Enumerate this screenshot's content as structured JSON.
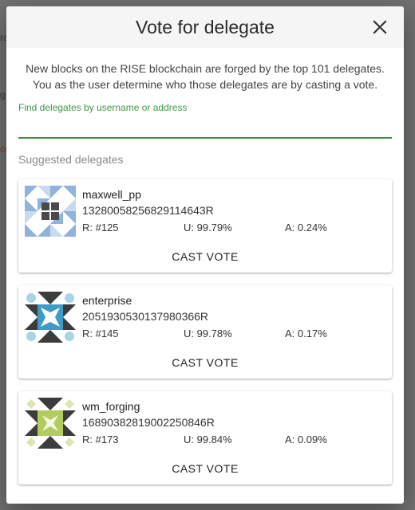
{
  "background": {
    "fragments": [
      "ra",
      "g",
      "co"
    ]
  },
  "dialog": {
    "title": "Vote for delegate",
    "close_icon": "close-icon",
    "intro": "New blocks on the RISE blockchain are forged by the top 101 delegates. You as the user determine who those delegates are by casting a vote.",
    "search": {
      "label": "Find delegates by username or address",
      "value": ""
    },
    "suggested_title": "Suggested delegates",
    "delegates": [
      {
        "name": "maxwell_pp",
        "address": "13280058256829114643R",
        "rank": "R: #125",
        "uptime": "U: 99.79%",
        "approval": "A: 0.24%",
        "action": "CAST VOTE",
        "avatar_colors": {
          "primary": "#8fb3dc",
          "secondary": "#4a4a4a",
          "background": "#ffffff"
        }
      },
      {
        "name": "enterprise",
        "address": "2051930530137980366R",
        "rank": "R: #145",
        "uptime": "U: 99.78%",
        "approval": "A: 0.17%",
        "action": "CAST VOTE",
        "avatar_colors": {
          "primary": "#3d9bc4",
          "secondary": "#3c3c3c",
          "accent": "#a8d4e6"
        }
      },
      {
        "name": "wm_forging",
        "address": "16890382819002250846R",
        "rank": "R: #173",
        "uptime": "U: 99.84%",
        "approval": "A: 0.09%",
        "action": "CAST VOTE",
        "avatar_colors": {
          "primary": "#b3cc5e",
          "secondary": "#3c3c3c",
          "accent": "#d8e8b0"
        }
      }
    ]
  },
  "colors": {
    "accent_green": "#3b8f44",
    "header_bg": "#f5f5f5",
    "overlay": "#707070"
  }
}
